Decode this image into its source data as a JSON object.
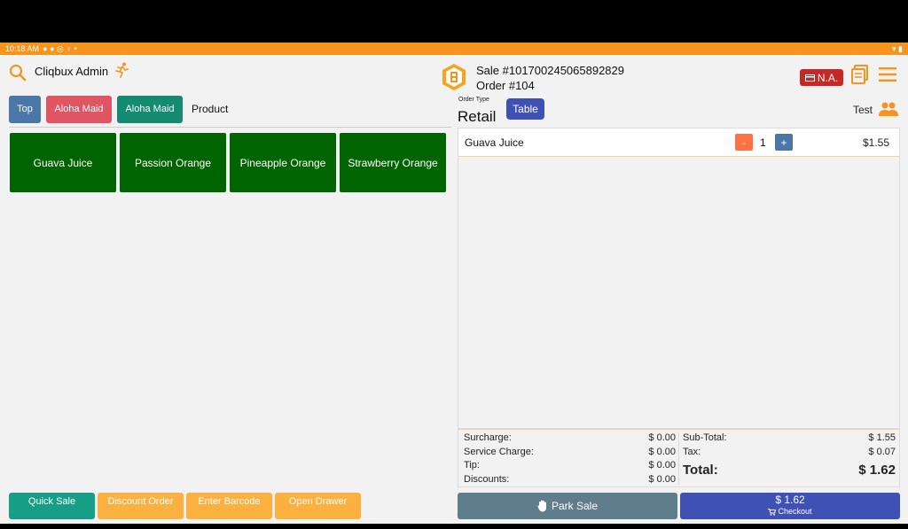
{
  "status_bar": {
    "time": "10:18 AM"
  },
  "header": {
    "admin_name": "Cliqbux Admin",
    "sale_number": "Sale #101700245065892829",
    "order_number": "Order #104",
    "na_badge": "N.A."
  },
  "categories": {
    "top": "Top",
    "aloha_1": "Aloha Maid",
    "aloha_2": "Aloha Maid",
    "current": "Product"
  },
  "products": [
    "Guava Juice",
    "Passion Orange",
    "Pineapple Orange",
    "Strawberry Orange"
  ],
  "bottom_buttons": {
    "quick_sale": "Quick Sale",
    "discount_order": "Discount Order",
    "enter_barcode": "Enter Barcode",
    "open_drawer": "Open Drawer"
  },
  "order": {
    "type_label": "Order Type",
    "type": "Retail",
    "table_button": "Table",
    "customer": "Test"
  },
  "cart": {
    "items": [
      {
        "name": "Guava Juice",
        "qty": "1",
        "price": "$1.55",
        "minus": "-",
        "plus": "+"
      }
    ]
  },
  "totals": {
    "surcharge_label": "Surcharge:",
    "surcharge": "$ 0.00",
    "service_label": "Service Charge:",
    "service": "$ 0.00",
    "tip_label": "Tip:",
    "tip": "$ 0.00",
    "discounts_label": "Discounts:",
    "discounts": "$ 0.00",
    "subtotal_label": "Sub-Total:",
    "subtotal": "$ 1.55",
    "tax_label": "Tax:",
    "tax": "$ 0.07",
    "total_label": "Total:",
    "total": "$ 1.62"
  },
  "actions": {
    "park_sale": "Park Sale",
    "checkout_amount": "$ 1.62",
    "checkout": "Checkout"
  },
  "colors": {
    "accent_orange": "#f7941d",
    "product_green": "#006400",
    "primary_indigo": "#3f51b5",
    "danger_red": "#c62828"
  }
}
